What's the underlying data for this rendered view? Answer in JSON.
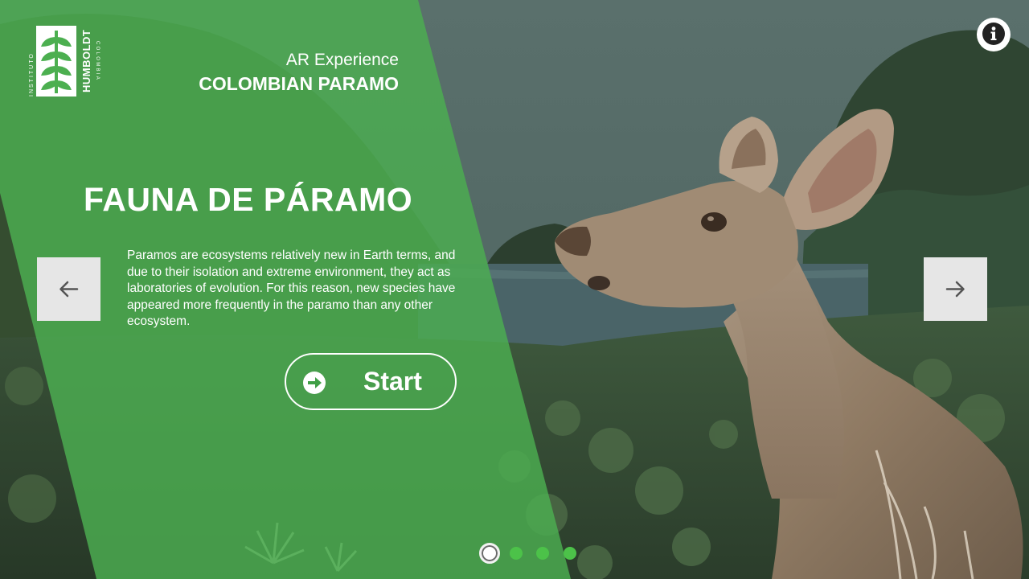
{
  "brand": {
    "institute_text": "INSTITUTO",
    "name": "HUMBOLDT",
    "country_text": "COLOMBIA"
  },
  "header": {
    "kicker": "AR Experience",
    "subtitle": "COLOMBIAN PARAMO"
  },
  "slide": {
    "title": "FAUNA DE PÁRAMO",
    "description": "Paramos are ecosystems relatively new in Earth terms, and due to their isolation and extreme environment, they act as laboratories of evolution. For this reason, new species have appeared more frequently in the paramo than any other ecosystem.",
    "start_label": "Start",
    "start_icon": "arrow-right-circle-icon"
  },
  "navigation": {
    "prev_icon": "arrow-left-icon",
    "next_icon": "arrow-right-icon",
    "info_icon": "info-icon"
  },
  "pagination": {
    "total": 4,
    "active_index": 0
  },
  "colors": {
    "panel_green": "#4caf50",
    "dot_green": "#4cc249",
    "nav_bg": "#e6e6e6"
  }
}
